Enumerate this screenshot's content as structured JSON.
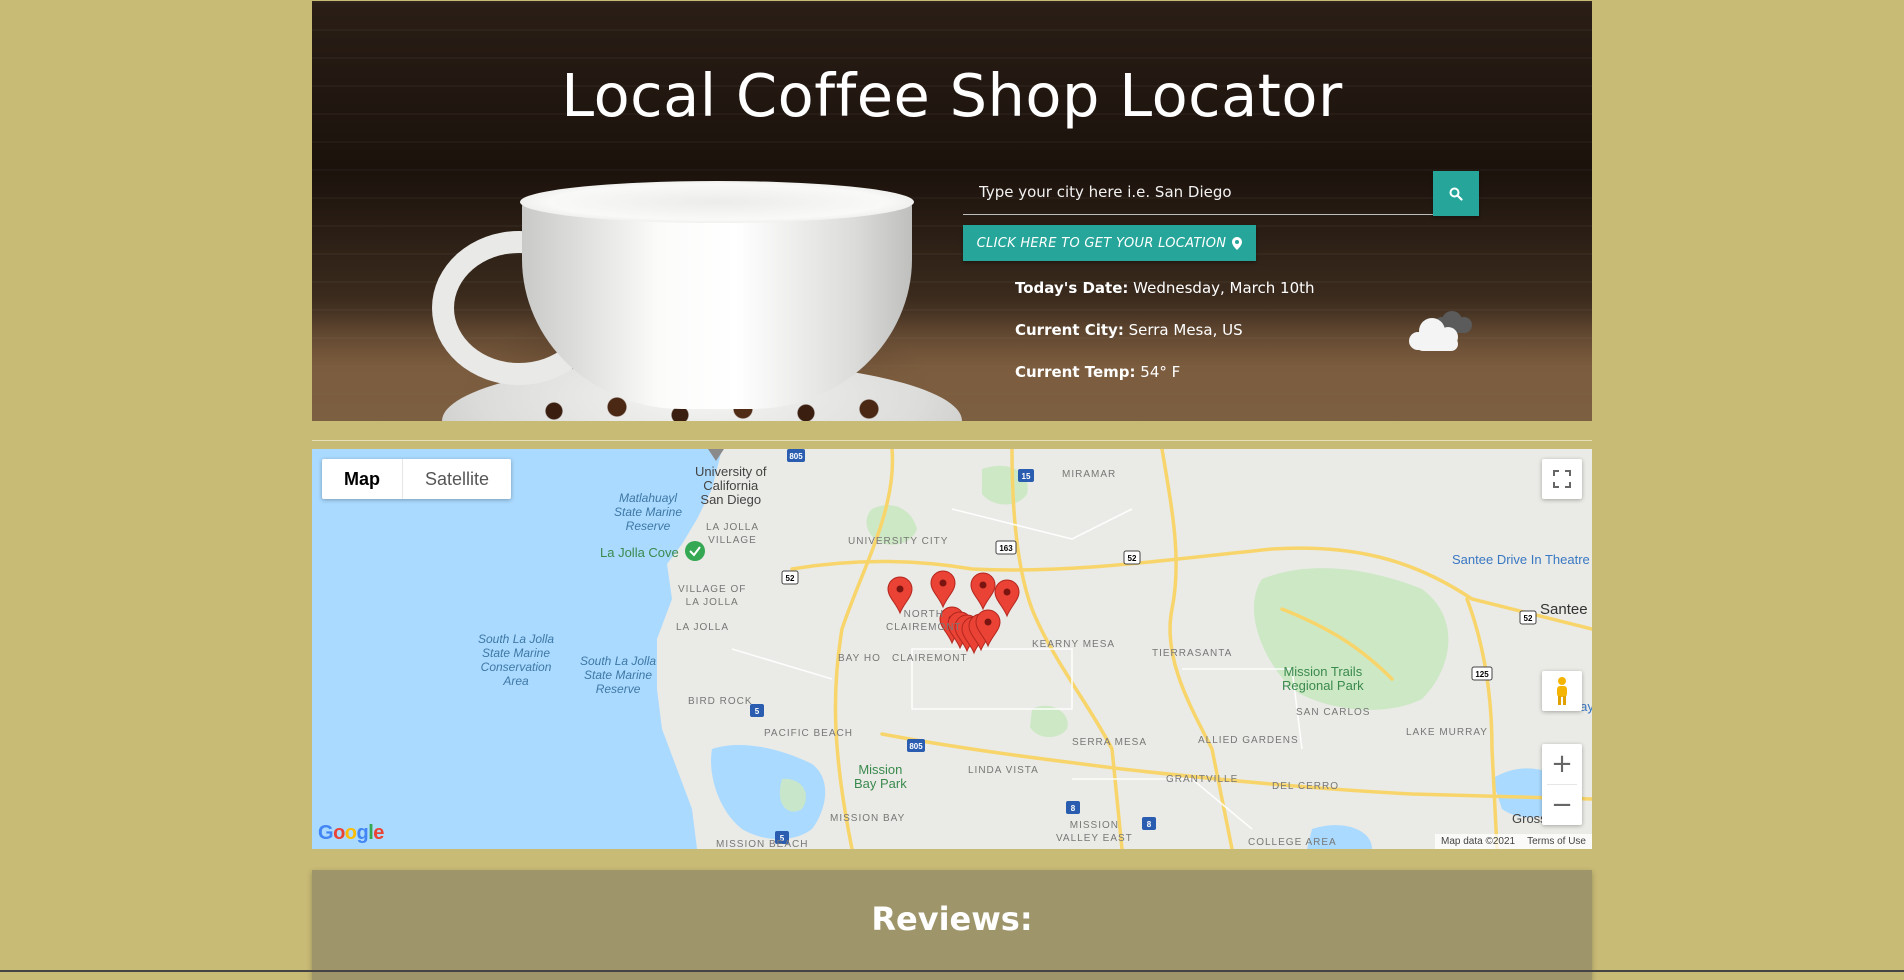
{
  "hero": {
    "title": "Local Coffee Shop Locator",
    "search_placeholder": "Type your city here i.e. San Diego",
    "search_icon": "search-icon",
    "location_button_label": "CLICK HERE TO GET YOUR LOCATION",
    "location_icon": "map-marker-icon",
    "date_label": "Today's Date:",
    "date_value": "Wednesday, March 10th",
    "city_label": "Current City:",
    "city_value": "Serra Mesa, US",
    "temp_label": "Current Temp:",
    "temp_value": "54° F",
    "weather_icon": "cloudy-night-icon"
  },
  "map": {
    "type_tabs": [
      "Map",
      "Satellite"
    ],
    "active_tab": "Map",
    "labels": {
      "ucsd": [
        "University of",
        "California",
        "San Diego"
      ],
      "matlahuayl": [
        "Matlahuayl",
        "State Marine",
        "Reserve"
      ],
      "la_jolla_village": [
        "LA JOLLA",
        "VILLAGE"
      ],
      "university_city": "UNIVERSITY CITY",
      "miramar": "MIRAMAR",
      "la_jolla_cove": "La Jolla Cove",
      "village_of_la_jolla": [
        "VILLAGE OF",
        "LA JOLLA"
      ],
      "la_jolla": "LA JOLLA",
      "north_clairemont": [
        "NORTH",
        "CLAIREMONT"
      ],
      "south_la_jolla_conservation": [
        "South La Jolla",
        "State Marine",
        "Conservation",
        "Area"
      ],
      "south_la_jolla_reserve": [
        "South La Jolla",
        "State Marine",
        "Reserve"
      ],
      "bay_ho": "BAY HO",
      "clairemont": "CLAIREMONT",
      "kearny_mesa": "KEARNY MESA",
      "tierrasanta": "TIERRASANTA",
      "mission_trails": [
        "Mission Trails",
        "Regional Park"
      ],
      "santee_drive_in": "Santee Drive In Theatre",
      "santee": "Santee",
      "bird_rock": "BIRD ROCK",
      "san_carlos": "SAN CARLOS",
      "parkway": "Parkway P",
      "pacific_beach": "PACIFIC BEACH",
      "serra_mesa": "SERRA MESA",
      "allied_gardens": "ALLIED GARDENS",
      "lake_murray": "LAKE MURRAY",
      "mission_bay_park": [
        "Mission",
        "Bay Park"
      ],
      "linda_vista": "LINDA VISTA",
      "grantville": "GRANTVILLE",
      "del_cerro": "DEL CERRO",
      "grossmont": "Grossmo",
      "mission_bay": "MISSION BAY",
      "mission_valley_east": [
        "MISSION",
        "VALLEY EAST"
      ],
      "mission_beach": "MISSION BEACH",
      "college_area": "COLLEGE AREA"
    },
    "highway_shields": [
      "805",
      "15",
      "163",
      "52",
      "52",
      "52",
      "125",
      "5",
      "805",
      "5",
      "8",
      "8"
    ],
    "marker_count": 10,
    "attribution": "Map data ©2021",
    "terms": "Terms of Use",
    "logo": "Google",
    "fullscreen_icon": "fullscreen-icon",
    "pegman_icon": "pegman-icon",
    "zoom_in": "+",
    "zoom_out": "−"
  },
  "reviews": {
    "title": "Reviews:"
  },
  "colors": {
    "page_bg": "#c8bb76",
    "accent": "#26a69a",
    "reviews_bg": "#9e956b",
    "water": "#aadaff",
    "marker": "#ea4335"
  }
}
